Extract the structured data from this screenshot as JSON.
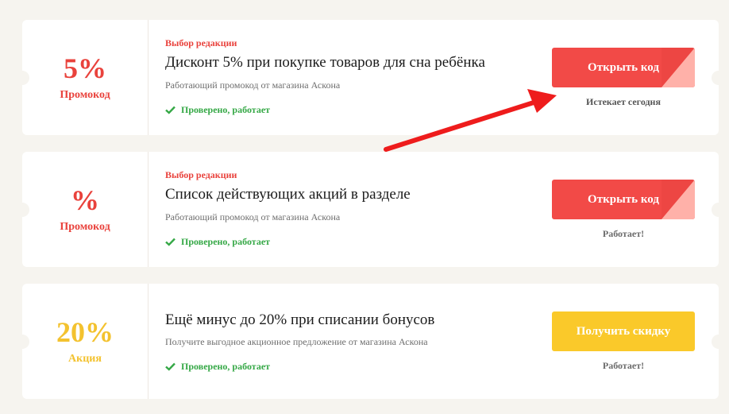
{
  "offers": [
    {
      "discount": "5%",
      "type": "Промокод",
      "editor_pick": "Выбор редакции",
      "title": "Дисконт 5% при покупке товаров для сна ребёнка",
      "subtitle": "Работающий промокод от магазина Аскона",
      "verified": "Проверено, работает",
      "button": "Открыть код",
      "status": "Истекает сегодня"
    },
    {
      "discount": "%",
      "type": "Промокод",
      "editor_pick": "Выбор редакции",
      "title": "Список действующих акций в разделе",
      "subtitle": "Работающий промокод от магазина Аскона",
      "verified": "Проверено, работает",
      "button": "Открыть код",
      "status": "Работает!"
    },
    {
      "discount": "20%",
      "type": "Акция",
      "title": "Ещё минус до 20% при списании бонусов",
      "subtitle": "Получите выгодное акционное предложение от магазина Аскона",
      "verified": "Проверено, работает",
      "button": "Получить скидку",
      "status": "Работает!"
    }
  ],
  "colors": {
    "red": "#e9423c",
    "red_button": "#f24a47",
    "yellow": "#f3c22f",
    "yellow_button": "#fac92a",
    "green": "#35a846",
    "annotation_arrow": "#ee1c1c"
  },
  "icons": [
    "check-icon",
    "annotation-arrow"
  ]
}
